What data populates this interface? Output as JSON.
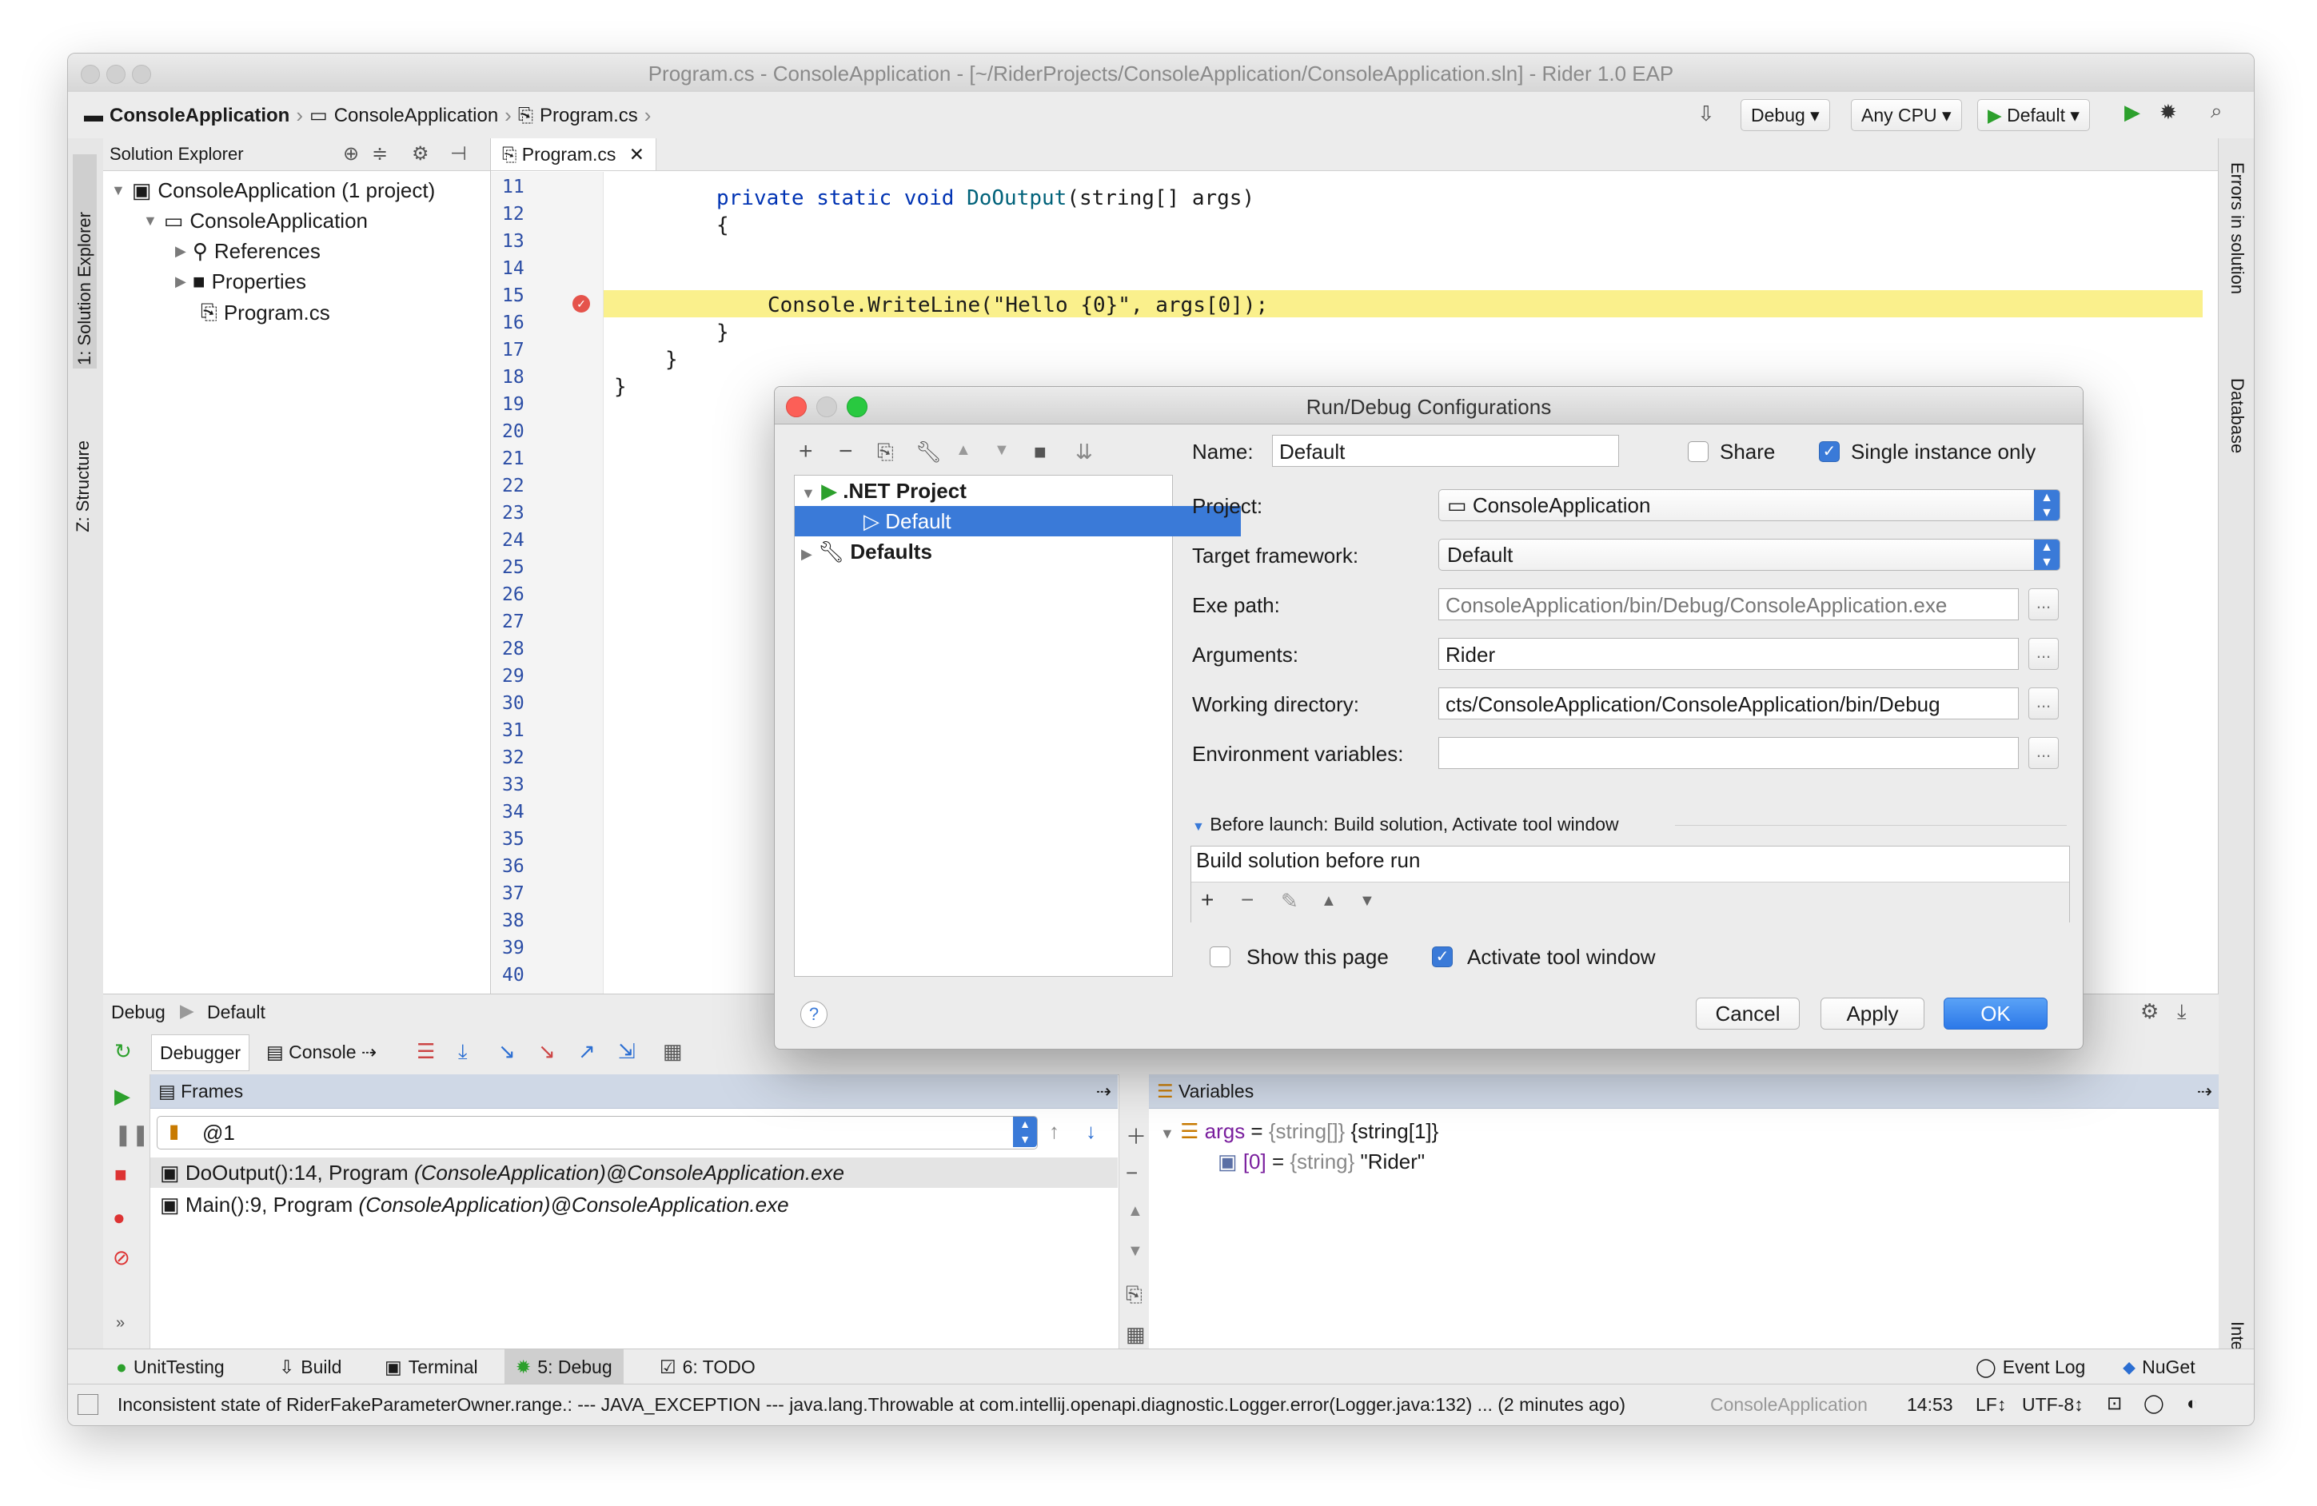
{
  "window": {
    "title": "Program.cs - ConsoleApplication - [~/RiderProjects/ConsoleApplication/ConsoleApplication.sln] - Rider 1.0 EAP"
  },
  "navbar": {
    "breadcrumbs": [
      "ConsoleApplication",
      "ConsoleApplication",
      "Program.cs"
    ],
    "config_debug": "Debug",
    "config_cpu": "Any CPU",
    "config_run": "Default"
  },
  "left_tabs": {
    "solution": "1: Solution Explorer",
    "structure": "Z: Structure"
  },
  "right_tabs": {
    "errors": "Errors in solution",
    "database": "Database",
    "internal": "Internal"
  },
  "solution": {
    "header": "Solution Explorer",
    "items": [
      "ConsoleApplication (1 project)",
      "ConsoleApplication",
      "References",
      "Properties",
      "Program.cs"
    ]
  },
  "editor": {
    "tab": "Program.cs",
    "lines": [
      "11",
      "12",
      "13",
      "14",
      "15",
      "16",
      "17",
      "18",
      "19",
      "20",
      "21",
      "22",
      "23",
      "24",
      "25",
      "26",
      "27",
      "28",
      "29",
      "30",
      "31",
      "32",
      "33",
      "34",
      "35",
      "36",
      "37",
      "38",
      "39",
      "40"
    ],
    "code": {
      "l12_kw": "private static void ",
      "l12_m": "DoOutput",
      "l12_rest": "(string[] args)",
      "l13": "{",
      "l14": "Console.WriteLine(\"Hello {0}\", args[0]);",
      "l15": "}",
      "l16": "}",
      "l17": "}"
    }
  },
  "dialog": {
    "title": "Run/Debug Configurations",
    "tree": [
      ".NET Project",
      "Default",
      "Defaults"
    ],
    "name_label": "Name:",
    "name_value": "Default",
    "share": "Share",
    "single_instance": "Single instance only",
    "project_label": "Project:",
    "project_value": "ConsoleApplication",
    "framework_label": "Target framework:",
    "framework_value": "Default",
    "exe_label": "Exe path:",
    "exe_value": "ConsoleApplication/bin/Debug/ConsoleApplication.exe",
    "args_label": "Arguments:",
    "args_value": "Rider",
    "workdir_label": "Working directory:",
    "workdir_value": "cts/ConsoleApplication/ConsoleApplication/bin/Debug",
    "env_label": "Environment variables:",
    "env_value": "",
    "dots": "...",
    "before_launch": "Before launch: Build solution, Activate tool window",
    "build_item": "Build solution before run",
    "show_page": "Show this page",
    "activate_tool": "Activate tool window",
    "help": "?",
    "cancel": "Cancel",
    "apply": "Apply",
    "ok": "OK"
  },
  "debug": {
    "header_label": "Debug",
    "header_config": "Default",
    "tab_debugger": "Debugger",
    "tab_console": "Console",
    "frames_header": "Frames",
    "thread": "@1",
    "frames": [
      {
        "a": "DoOutput():14, Program ",
        "b": "(ConsoleApplication)@ConsoleApplication.exe"
      },
      {
        "a": "Main():9, Program ",
        "b": "(ConsoleApplication)@ConsoleApplication.exe"
      }
    ],
    "variables_header": "Variables",
    "var1_name": "args",
    "var1_eq": " = ",
    "var1_type": "{string[]}",
    "var1_val": " {string[1]}",
    "var2_name": "[0]",
    "var2_eq": " = ",
    "var2_type": "{string}",
    "var2_val": " \"Rider\""
  },
  "bottom_tools": {
    "unittesting": "UnitTesting",
    "build": "Build",
    "terminal": "Terminal",
    "debug": "5: Debug",
    "todo": "6: TODO",
    "eventlog": "Event Log",
    "nuget": "NuGet"
  },
  "status": {
    "message": "Inconsistent state of RiderFakeParameterOwner.range.: --- JAVA_EXCEPTION --- java.lang.Throwable at com.intellij.openapi.diagnostic.Logger.error(Logger.java:132) ... (2 minutes ago)",
    "project": "ConsoleApplication",
    "position": "14:53",
    "line_sep": "LF↕",
    "encoding": "UTF-8↕"
  },
  "colors": {
    "accent": "#3a7ad8",
    "highlight": "#faf08c",
    "keyword": "#0033b3",
    "run_green": "#2ca02c"
  }
}
